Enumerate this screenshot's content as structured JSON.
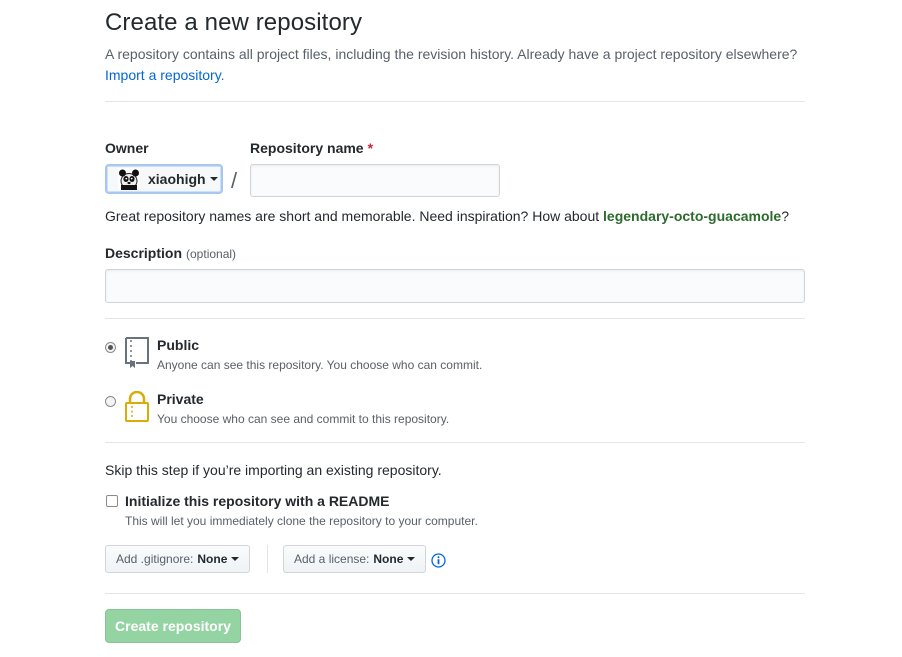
{
  "page": {
    "title": "Create a new repository",
    "subtitle": "A repository contains all project files, including the revision history. Already have a project repository elsewhere?",
    "import_link": "Import a repository",
    "import_period": "."
  },
  "owner": {
    "label": "Owner",
    "name": "xiaohigh"
  },
  "repo_name": {
    "label": "Repository name",
    "required_mark": "*",
    "value": "",
    "separator": "/"
  },
  "hint": {
    "prefix": "Great repository names are short and memorable. Need inspiration? How about ",
    "suggestion": "legendary-octo-guacamole",
    "suffix": "?"
  },
  "description": {
    "label": "Description",
    "optional": "(optional)",
    "value": ""
  },
  "visibility": {
    "selected": "public",
    "public_title": "Public",
    "public_desc": "Anyone can see this repository. You choose who can commit.",
    "private_title": "Private",
    "private_desc": "You choose who can see and commit to this repository."
  },
  "init": {
    "skip_text": "Skip this step if you’re importing an existing repository.",
    "readme_label": "Initialize this repository with a README",
    "readme_desc": "This will let you immediately clone the repository to your computer.",
    "readme_checked": false
  },
  "gitignore": {
    "label": "Add .gitignore:",
    "value": "None"
  },
  "license": {
    "label": "Add a license:",
    "value": "None"
  },
  "info_icon": "info-icon",
  "submit": {
    "label": "Create repository"
  },
  "colors": {
    "link": "#0366d6",
    "suggestion": "#2d6a2d",
    "create_button": "#94d3a2",
    "required": "#cb2431"
  }
}
